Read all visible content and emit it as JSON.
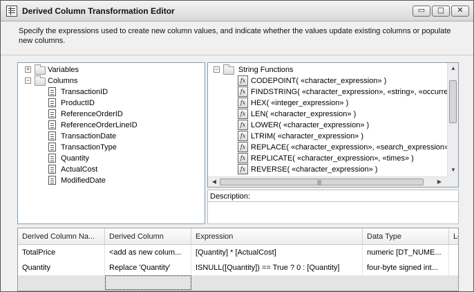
{
  "window": {
    "title": "Derived Column Transformation Editor",
    "buttons": {
      "minimize": "▭",
      "maximize": "▢",
      "close": "✕"
    }
  },
  "instructions": "Specify the expressions used to create new column values, and indicate whether the values update existing columns or populate new columns.",
  "left_tree": {
    "variables_label": "Variables",
    "columns_label": "Columns",
    "columns": [
      "TransactionID",
      "ProductID",
      "ReferenceOrderID",
      "ReferenceOrderLineID",
      "TransactionDate",
      "TransactionType",
      "Quantity",
      "ActualCost",
      "ModifiedDate"
    ]
  },
  "function_tree": {
    "category": "String Functions",
    "functions": [
      "CODEPOINT( «character_expression» )",
      "FINDSTRING( «character_expression», «string», «occurrence» )",
      "HEX( «integer_expression» )",
      "LEN( «character_expression» )",
      "LOWER( «character_expression» )",
      "LTRIM( «character_expression» )",
      "REPLACE( «character_expression», «search_expression», «replacement_expression» )",
      "REPLICATE( «character_expression», «times» )",
      "REVERSE( «character_expression» )"
    ],
    "fx_glyph": "fx"
  },
  "description_label": "Description:",
  "grid": {
    "headers": [
      "Derived Column Na...",
      "Derived Column",
      "Expression",
      "Data Type",
      "Le"
    ],
    "rows": [
      [
        "TotalPrice",
        "<add as new colum...",
        "[Quantity] * [ActualCost]",
        "numeric [DT_NUME..."
      ],
      [
        "Quantity",
        "Replace 'Quantity'",
        "ISNULL([Quantity]) == True ? 0 : [Quantity]",
        "four-byte signed int..."
      ]
    ]
  }
}
